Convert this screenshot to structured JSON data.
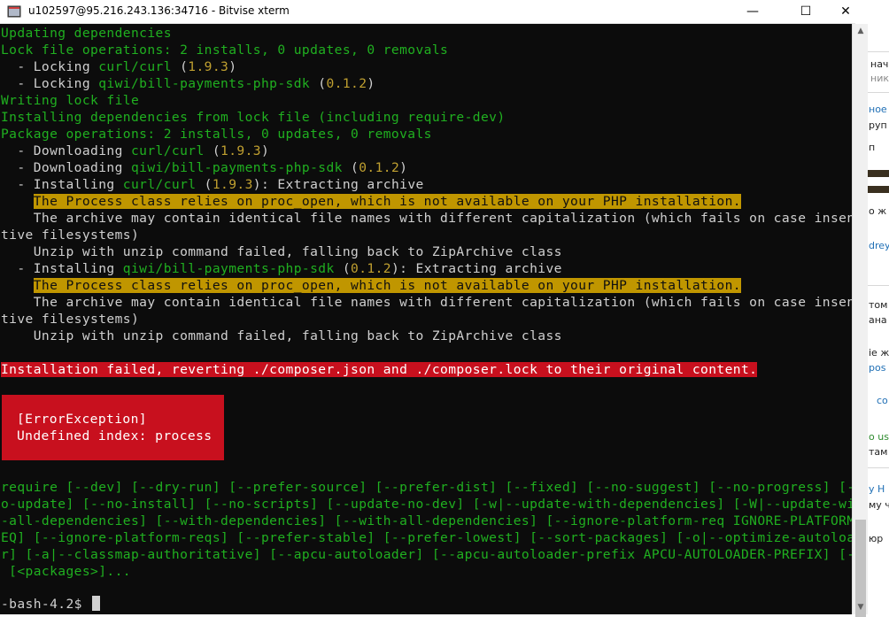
{
  "window": {
    "title": "u102597@95.216.243.136:34716 - Bitvise xterm",
    "minimize_glyph": "—",
    "maximize_glyph": "☐",
    "close_glyph": "✕"
  },
  "terminal": {
    "l01": "Updating dependencies",
    "l02": "Lock file operations: 2 installs, 0 updates, 0 removals",
    "l03a": "  - Locking ",
    "l03b": "curl/curl",
    "l03c": " (",
    "l03d": "1.9.3",
    "l03e": ")",
    "l04a": "  - Locking ",
    "l04b": "qiwi/bill-payments-php-sdk",
    "l04c": " (",
    "l04d": "0.1.2",
    "l04e": ")",
    "l05": "Writing lock file",
    "l06": "Installing dependencies from lock file (including require-dev)",
    "l07": "Package operations: 2 installs, 0 updates, 0 removals",
    "l08a": "  - Downloading ",
    "l08b": "curl/curl",
    "l08c": " (",
    "l08d": "1.9.3",
    "l08e": ")",
    "l09a": "  - Downloading ",
    "l09b": "qiwi/bill-payments-php-sdk",
    "l09c": " (",
    "l09d": "0.1.2",
    "l09e": ")",
    "l10a": "  - Installing ",
    "l10b": "curl/curl",
    "l10c": " (",
    "l10d": "1.9.3",
    "l10e": "): Extracting archive",
    "l11pad": "    ",
    "l11": "The Process class relies on proc_open, which is not available on your PHP installation.",
    "l12": "    The archive may contain identical file names with different capitalization (which fails on case insensi",
    "l13": "tive filesystems)",
    "l14": "    Unzip with unzip command failed, falling back to ZipArchive class",
    "l15a": "  - Installing ",
    "l15b": "qiwi/bill-payments-php-sdk",
    "l15c": " (",
    "l15d": "0.1.2",
    "l15e": "): Extracting archive",
    "l16pad": "    ",
    "l16": "The Process class relies on proc_open, which is not available on your PHP installation.",
    "l17": "    The archive may contain identical file names with different capitalization (which fails on case insensi",
    "l18": "tive filesystems)",
    "l19": "    Unzip with unzip command failed, falling back to ZipArchive class",
    "l20": "Installation failed, reverting ./composer.json and ./composer.lock to their original content.",
    "err1": "[ErrorException]",
    "err2": "Undefined index: process",
    "u1": "require [--dev] [--dry-run] [--prefer-source] [--prefer-dist] [--fixed] [--no-suggest] [--no-progress] [--n",
    "u2": "o-update] [--no-install] [--no-scripts] [--update-no-dev] [-w|--update-with-dependencies] [-W|--update-with",
    "u3": "-all-dependencies] [--with-dependencies] [--with-all-dependencies] [--ignore-platform-req IGNORE-PLATFORM-R",
    "u4": "EQ] [--ignore-platform-reqs] [--prefer-stable] [--prefer-lowest] [--sort-packages] [-o|--optimize-autoloade",
    "u5": "r] [-a|--classmap-authoritative] [--apcu-autoloader] [--apcu-autoloader-prefix APCU-AUTOLOADER-PREFIX] [--]",
    "u6": " [<packages>]...",
    "prompt": "-bash-4.2$ "
  },
  "background_page": {
    "t1": "нач",
    "t2": "нико",
    "t3": "ное",
    "t4": "руп",
    "t5": "п",
    "t6": "о ж",
    "t7": "drey",
    "t8": "том",
    "t9": "ана",
    "t10": "ie ж",
    "t11": "pos",
    "t12": "со",
    "t13": "o us",
    "t14": "там",
    "t15": "y H",
    "t16": "му ч",
    "t17": "юр"
  },
  "colors": {
    "terminal_bg": "#0c0c0c",
    "green": "#20b020",
    "yellow": "#c0a030",
    "warning_bg": "#c09600",
    "error_bg": "#c8101e"
  }
}
